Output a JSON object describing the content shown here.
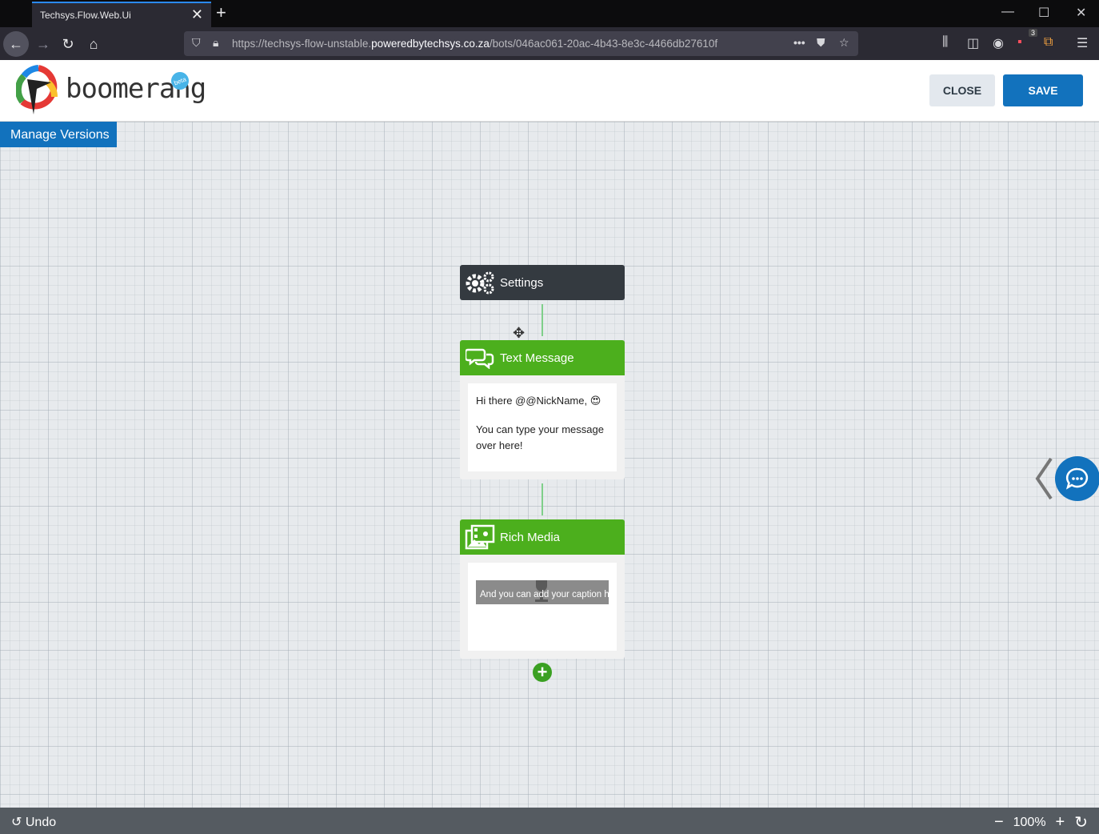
{
  "browser": {
    "tab_title": "Techsys.Flow.Web.Ui",
    "url_prefix": "https://techsys-flow-unstable.",
    "url_domain": "poweredbytechsys.co.za",
    "url_path": "/bots/046ac061-20ac-4b43-8e3c-4466db27610f",
    "notification_badge": "3"
  },
  "header": {
    "brand": "boomerang",
    "beta": "beta",
    "close_label": "CLOSE",
    "save_label": "SAVE"
  },
  "canvas": {
    "manage_versions": "Manage Versions",
    "nodes": [
      {
        "title": "Settings",
        "icon": "gears-icon"
      },
      {
        "title": "Text Message",
        "icon": "chat-bubbles-icon",
        "line1": "Hi there @@NickName, 😍",
        "line2": "You can type your message over here!"
      },
      {
        "title": "Rich Media",
        "icon": "media-icon",
        "caption": "And you can add your caption here"
      }
    ]
  },
  "footer": {
    "undo": "Undo",
    "zoom": "100%"
  },
  "colors": {
    "primary": "#1272bd",
    "node_green": "#4caf1d",
    "node_dark": "#343a40"
  }
}
